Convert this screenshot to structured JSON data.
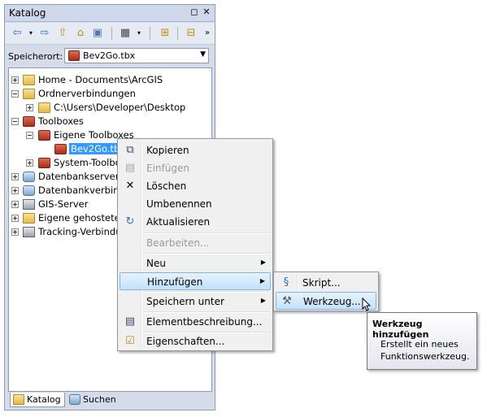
{
  "panel": {
    "title": "Katalog",
    "title_buttons": [
      "pin-icon",
      "close-icon"
    ],
    "toolbar": [
      "back-icon",
      "forward-icon",
      "up-folder-icon",
      "home-icon",
      "connect-folder-icon",
      "view-options-icon",
      "add-data-icon",
      "tree-view-icon",
      "overflow-icon"
    ],
    "location_label": "Speicherort:",
    "location_value": "Bev2Go.tbx"
  },
  "tree": [
    {
      "text": "Home - Documents\\ArcGIS",
      "icon": "home-folder-icon",
      "expander": "plus"
    },
    {
      "text": "Ordnerverbindungen",
      "icon": "folder-icon",
      "expander": "minus"
    },
    {
      "text": "C:\\Users\\Developer\\Desktop",
      "icon": "folder-icon",
      "expander": "plus"
    },
    {
      "text": "Toolboxes",
      "icon": "toolbox-icon",
      "expander": "minus"
    },
    {
      "text": "Eigene Toolboxes",
      "icon": "toolbox-icon",
      "expander": "minus"
    },
    {
      "text": "Bev2Go.tbx",
      "icon": "toolbox-icon",
      "expander": "none",
      "selected": true
    },
    {
      "text": "System-Toolboxes",
      "icon": "toolbox-icon",
      "expander": "plus"
    },
    {
      "text": "Datenbankserver",
      "icon": "database-server-icon",
      "expander": "plus"
    },
    {
      "text": "Datenbankverbindungen",
      "icon": "database-connection-icon",
      "expander": "plus"
    },
    {
      "text": "GIS-Server",
      "icon": "gis-server-icon",
      "expander": "plus"
    },
    {
      "text": "Eigene gehostete Dienste",
      "icon": "hosted-services-icon",
      "expander": "plus"
    },
    {
      "text": "Tracking-Verbindungen",
      "icon": "tracking-icon",
      "expander": "plus"
    }
  ],
  "tabs": [
    {
      "label": "Katalog",
      "icon": "catalog-icon",
      "active": true
    },
    {
      "label": "Suchen",
      "icon": "search-window-icon",
      "active": false
    }
  ],
  "context_menu": [
    {
      "label": "Kopieren",
      "icon": "copy-icon",
      "disabled": false
    },
    {
      "label": "Einfügen",
      "icon": "paste-icon",
      "disabled": true
    },
    {
      "label": "Löschen",
      "icon": "delete-icon",
      "disabled": false
    },
    {
      "label": "Umbenennen",
      "icon": "",
      "disabled": false
    },
    {
      "label": "Aktualisieren",
      "icon": "refresh-icon",
      "disabled": false
    },
    {
      "label": "Bearbeiten...",
      "icon": "",
      "disabled": true
    },
    {
      "label": "Neu",
      "icon": "",
      "disabled": false,
      "submenu": true
    },
    {
      "label": "Hinzufügen",
      "icon": "",
      "disabled": false,
      "submenu": true,
      "highlighted": true
    },
    {
      "label": "Speichern unter",
      "icon": "",
      "disabled": false,
      "submenu": true
    },
    {
      "label": "Elementbeschreibung...",
      "icon": "description-icon",
      "disabled": false
    },
    {
      "label": "Eigenschaften...",
      "icon": "properties-icon",
      "disabled": false
    }
  ],
  "submenu": [
    {
      "label": "Skript...",
      "icon": "script-icon"
    },
    {
      "label": "Werkzeug...",
      "icon": "tool-hammer-icon",
      "highlighted": true
    }
  ],
  "tooltip": {
    "title": "Werkzeug hinzufügen",
    "body": "Erstellt ein neues Funktionswerkzeug."
  },
  "colors": {
    "selection": "#3399ff",
    "menu_highlight_border": "#7eb4ea",
    "panel_background": "#d6dbe9"
  }
}
